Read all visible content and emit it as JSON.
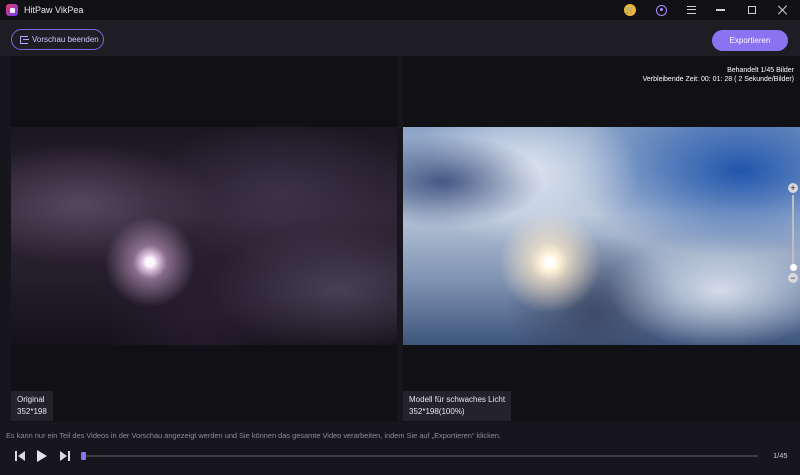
{
  "window": {
    "title": "HitPaw VikPea"
  },
  "toolbar": {
    "end_preview_label": "Vorschau beenden",
    "export_label": "Exportieren"
  },
  "preview": {
    "left": {
      "name": "Original",
      "resolution": "352*198"
    },
    "right": {
      "name": "Modell für schwaches Licht",
      "resolution": "352*198(100%)",
      "processed": "Behandelt 1/45 Bilder",
      "remaining": "Verbleibende Zeit: 00: 01: 28 ( 2 Sekunde/Bilder)"
    },
    "zoom_level": 0
  },
  "notice": "Es kann nur ein Teil des Videos in der Vorschau angezeigt werden und Sie können das gesamte Video verarbeiten, indem Sie auf „Exportieren“ klicken.",
  "player": {
    "frame_counter": "1/45",
    "progress": 0.0
  },
  "colors": {
    "accent": "#8a72f0",
    "background": "#17161c",
    "panel": "#111015"
  }
}
